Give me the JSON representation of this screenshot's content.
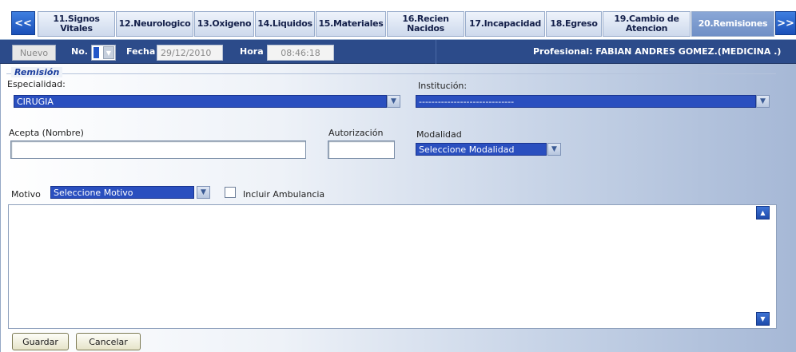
{
  "tabs": {
    "prev_label": "<<",
    "next_label": ">>",
    "items": [
      {
        "label": "11.Signos\nVitales"
      },
      {
        "label": "12.Neurologico"
      },
      {
        "label": "13.Oxigeno"
      },
      {
        "label": "14.Liquidos"
      },
      {
        "label": "15.Materiales"
      },
      {
        "label": "16.Recien\nNacidos"
      },
      {
        "label": "17.Incapacidad"
      },
      {
        "label": "18.Egreso"
      },
      {
        "label": "19.Cambio de\nAtencion"
      },
      {
        "label": "20.Remisiones"
      }
    ],
    "active_index": 9
  },
  "toolbar": {
    "nuevo_label": "Nuevo",
    "no_label": "No.",
    "fecha_label": "Fecha",
    "fecha_value": "29/12/2010",
    "hora_label": "Hora",
    "hora_value": "08:46:18",
    "profesional_text": "Profesional: FABIAN ANDRES GOMEZ.(MEDICINA .)"
  },
  "form": {
    "legend": "Remisión",
    "especialidad_label": "Especialidad:",
    "especialidad_value": "CIRUGIA",
    "institucion_label": "Institución:",
    "institucion_value": "------------------------------",
    "acepta_label": "Acepta (Nombre)",
    "autorizacion_label": "Autorización",
    "modalidad_label": "Modalidad",
    "modalidad_value": "Seleccione Modalidad",
    "motivo_label": "Motivo",
    "motivo_value": "Seleccione Motivo",
    "incluir_ambulancia_label": "Incluir Ambulancia",
    "incluir_ambulancia_checked": false
  },
  "actions": {
    "guardar_label": "Guardar",
    "cancelar_label": "Cancelar"
  },
  "icons": {
    "dropdown": "chevron-down-icon",
    "scroll_up": "arrow-up-icon",
    "scroll_down": "arrow-down-icon"
  },
  "colors": {
    "toolbar_bg": "#2c4b8a",
    "selected_blue": "#2a4fbf",
    "active_tab": "#7b9bcf"
  }
}
